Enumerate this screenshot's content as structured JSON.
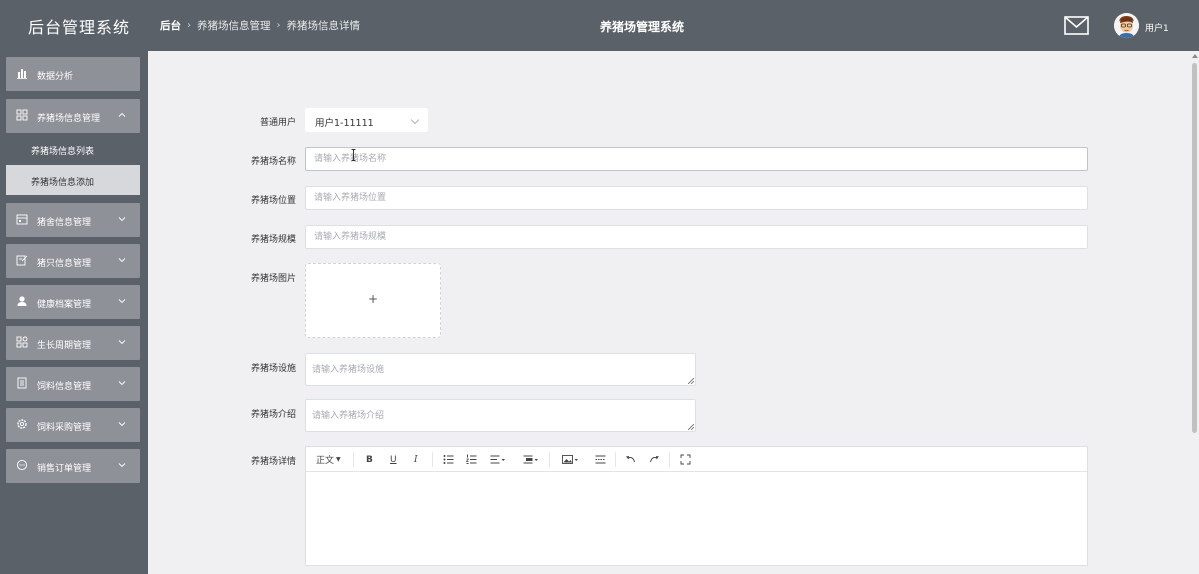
{
  "header": {
    "brand": "后台管理系统",
    "breadcrumbs": [
      "后台",
      "养猪场信息管理",
      "养猪场信息详情"
    ],
    "center_title": "养猪场管理系统",
    "username": "用户1"
  },
  "sidebar": {
    "items": [
      {
        "label": "数据分析",
        "icon": "bar-chart-icon"
      },
      {
        "label": "养猪场信息管理",
        "icon": "grid-icon",
        "expanded": true,
        "children": [
          {
            "label": "养猪场信息列表"
          },
          {
            "label": "养猪场信息添加",
            "active": true
          }
        ]
      },
      {
        "label": "猪舍信息管理",
        "icon": "calendar-icon"
      },
      {
        "label": "猪只信息管理",
        "icon": "edit-icon"
      },
      {
        "label": "健康档案管理",
        "icon": "user-icon"
      },
      {
        "label": "生长周期管理",
        "icon": "apps-icon"
      },
      {
        "label": "饲料信息管理",
        "icon": "document-icon"
      },
      {
        "label": "饲料采购管理",
        "icon": "settings-icon"
      },
      {
        "label": "销售订单管理",
        "icon": "chat-icon"
      }
    ]
  },
  "form": {
    "user": {
      "label": "普通用户",
      "value": "用户1-11111"
    },
    "name": {
      "label": "养猪场名称",
      "placeholder": "请输入养猪场名称"
    },
    "location": {
      "label": "养猪场位置",
      "placeholder": "请输入养猪场位置"
    },
    "scale": {
      "label": "养猪场规模",
      "placeholder": "请输入养猪场规模"
    },
    "image": {
      "label": "养猪场图片",
      "upload_symbol": "+"
    },
    "facilities": {
      "label": "养猪场设施",
      "placeholder": "请输入养猪场设施"
    },
    "intro": {
      "label": "养猪场介绍",
      "placeholder": "请输入养猪场介绍"
    },
    "details": {
      "label": "养猪场详情",
      "toolbar": {
        "format": "正文",
        "bold": "B",
        "underline": "U",
        "italic": "I"
      }
    }
  },
  "colors": {
    "header_bg": "#5b6168",
    "menu_bg": "#8e9298",
    "active_sub_bg": "#d6d8db",
    "main_bg": "#f0f0f3"
  }
}
